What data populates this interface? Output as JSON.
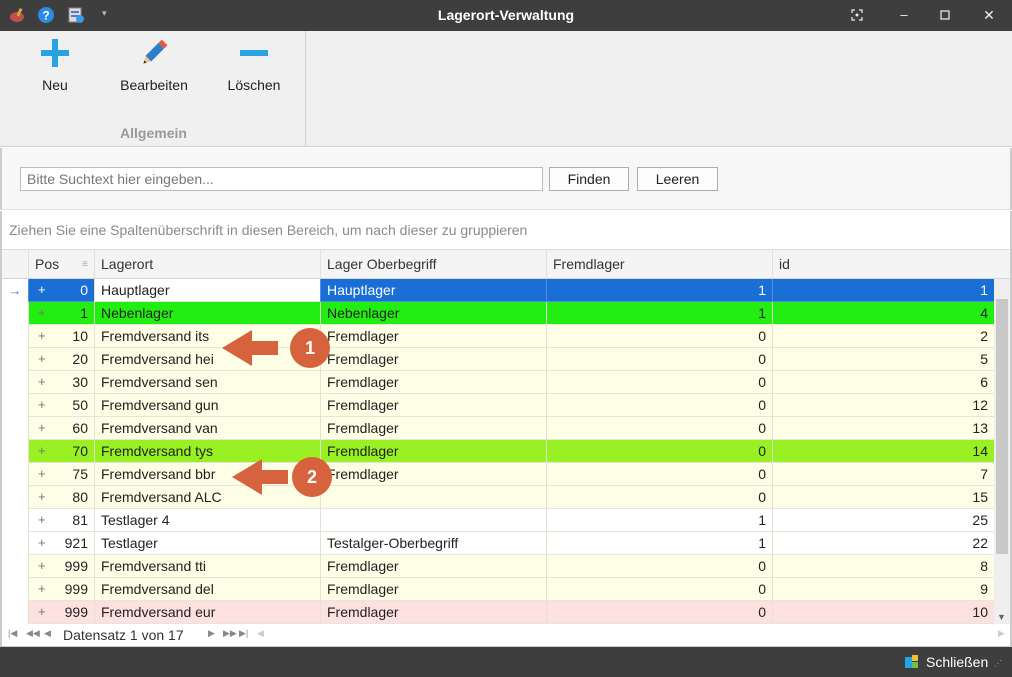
{
  "window": {
    "title": "Lagerort-Verwaltung"
  },
  "ribbon": {
    "buttons": [
      {
        "label": "Neu",
        "icon": "plus-icon"
      },
      {
        "label": "Bearbeiten",
        "icon": "pencil-icon"
      },
      {
        "label": "Löschen",
        "icon": "minus-icon"
      }
    ],
    "group_label": "Allgemein"
  },
  "search": {
    "placeholder": "Bitte Suchtext hier eingeben...",
    "value": "",
    "find_label": "Finden",
    "clear_label": "Leeren"
  },
  "group_hint": "Ziehen Sie eine Spaltenüberschrift in diesen Bereich, um nach dieser zu gruppieren",
  "grid": {
    "columns": [
      "Pos",
      "Lagerort",
      "Lager Oberbegriff",
      "Fremdlager",
      "id"
    ],
    "rows": [
      {
        "pos": "0",
        "lagerort": "Hauptlager",
        "oberbegriff": "Hauptlager",
        "fremdlager": "1",
        "id": "1",
        "style": "selected"
      },
      {
        "pos": "1",
        "lagerort": "Nebenlager",
        "oberbegriff": "Nebenlager",
        "fremdlager": "1",
        "id": "4",
        "style": "green"
      },
      {
        "pos": "10",
        "lagerort": "Fremdversand its",
        "oberbegriff": "Fremdlager",
        "fremdlager": "0",
        "id": "2",
        "style": "yellow"
      },
      {
        "pos": "20",
        "lagerort": "Fremdversand hei",
        "oberbegriff": "Fremdlager",
        "fremdlager": "0",
        "id": "5",
        "style": "yellow"
      },
      {
        "pos": "30",
        "lagerort": "Fremdversand sen",
        "oberbegriff": "Fremdlager",
        "fremdlager": "0",
        "id": "6",
        "style": "yellow"
      },
      {
        "pos": "50",
        "lagerort": "Fremdversand gun",
        "oberbegriff": "Fremdlager",
        "fremdlager": "0",
        "id": "12",
        "style": "yellow"
      },
      {
        "pos": "60",
        "lagerort": "Fremdversand van",
        "oberbegriff": "Fremdlager",
        "fremdlager": "0",
        "id": "13",
        "style": "yellow"
      },
      {
        "pos": "70",
        "lagerort": "Fremdversand tys",
        "oberbegriff": "Fremdlager",
        "fremdlager": "0",
        "id": "14",
        "style": "lime"
      },
      {
        "pos": "75",
        "lagerort": "Fremdversand bbr",
        "oberbegriff": "Fremdlager",
        "fremdlager": "0",
        "id": "7",
        "style": "yellow"
      },
      {
        "pos": "80",
        "lagerort": "Fremdversand ALC",
        "oberbegriff": "",
        "fremdlager": "0",
        "id": "15",
        "style": "yellow"
      },
      {
        "pos": "81",
        "lagerort": "Testlager 4",
        "oberbegriff": "",
        "fremdlager": "1",
        "id": "25",
        "style": "white"
      },
      {
        "pos": "921",
        "lagerort": "Testlager",
        "oberbegriff": "Testalger-Oberbegriff",
        "fremdlager": "1",
        "id": "22",
        "style": "white"
      },
      {
        "pos": "999",
        "lagerort": "Fremdversand tti",
        "oberbegriff": "Fremdlager",
        "fremdlager": "0",
        "id": "8",
        "style": "yellow"
      },
      {
        "pos": "999",
        "lagerort": "Fremdversand del",
        "oberbegriff": "Fremdlager",
        "fremdlager": "0",
        "id": "9",
        "style": "yellow"
      },
      {
        "pos": "999",
        "lagerort": "Fremdversand eur",
        "oberbegriff": "Fremdlager",
        "fremdlager": "0",
        "id": "10",
        "style": "pink"
      }
    ]
  },
  "navigator": {
    "text": "Datensatz 1 von 17"
  },
  "annotations": [
    {
      "label": "1"
    },
    {
      "label": "2"
    }
  ],
  "status": {
    "close_label": "Schließen"
  },
  "colors": {
    "selected": "#1a6fd4",
    "green": "#22ee11",
    "lime": "#99f022",
    "yellow": "#fefee6",
    "pink": "#fde0e0",
    "white": "#ffffff",
    "arrow": "#d6623e"
  }
}
